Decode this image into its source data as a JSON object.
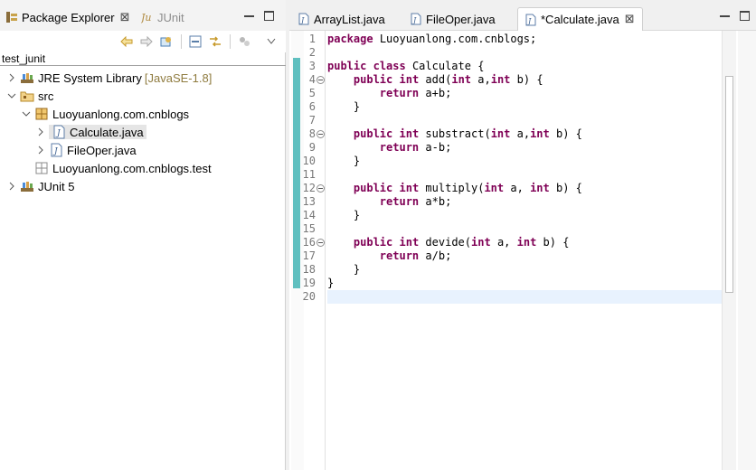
{
  "left_panel": {
    "tabs": [
      {
        "label": "Package Explorer",
        "close": "⊠"
      },
      {
        "label": "JUnit"
      }
    ],
    "project": "test_junit",
    "tree": [
      {
        "label": "JRE System Library",
        "decor": "[JavaSE-1.8]",
        "expanded": false
      },
      {
        "label": "src",
        "expanded": true
      },
      {
        "label": "Luoyuanlong.com.cnblogs",
        "expanded": true
      },
      {
        "label": "Calculate.java",
        "selected": true
      },
      {
        "label": "FileOper.java"
      },
      {
        "label": "Luoyuanlong.com.cnblogs.test"
      },
      {
        "label": "JUnit 5",
        "expanded": false
      }
    ]
  },
  "editor": {
    "tabs": [
      {
        "label": "ArrayList.java"
      },
      {
        "label": "FileOper.java"
      },
      {
        "label": "*Calculate.java",
        "active": true,
        "close": "⊠"
      }
    ],
    "lines": [
      {
        "n": "1",
        "code": "package Luoyuanlong.com.cnblogs;"
      },
      {
        "n": "2",
        "code": ""
      },
      {
        "n": "3",
        "code": "public class Calculate {"
      },
      {
        "n": "4",
        "code": "    public int add(int a,int b) {"
      },
      {
        "n": "5",
        "code": "        return a+b;"
      },
      {
        "n": "6",
        "code": "    }"
      },
      {
        "n": "7",
        "code": ""
      },
      {
        "n": "8",
        "code": "    public int substract(int a,int b) {"
      },
      {
        "n": "9",
        "code": "        return a-b;"
      },
      {
        "n": "10",
        "code": "    }"
      },
      {
        "n": "11",
        "code": ""
      },
      {
        "n": "12",
        "code": "    public int multiply(int a, int b) {"
      },
      {
        "n": "13",
        "code": "        return a*b;"
      },
      {
        "n": "14",
        "code": "    }"
      },
      {
        "n": "15",
        "code": ""
      },
      {
        "n": "16",
        "code": "    public int devide(int a, int b) {"
      },
      {
        "n": "17",
        "code": "        return a/b;"
      },
      {
        "n": "18",
        "code": "    }"
      },
      {
        "n": "19",
        "code": "}"
      },
      {
        "n": "20",
        "code": ""
      }
    ]
  },
  "colors": {
    "keyword": "#7f0055",
    "change_bar": "#5fbfbf",
    "current_line": "#e8f2fe"
  }
}
